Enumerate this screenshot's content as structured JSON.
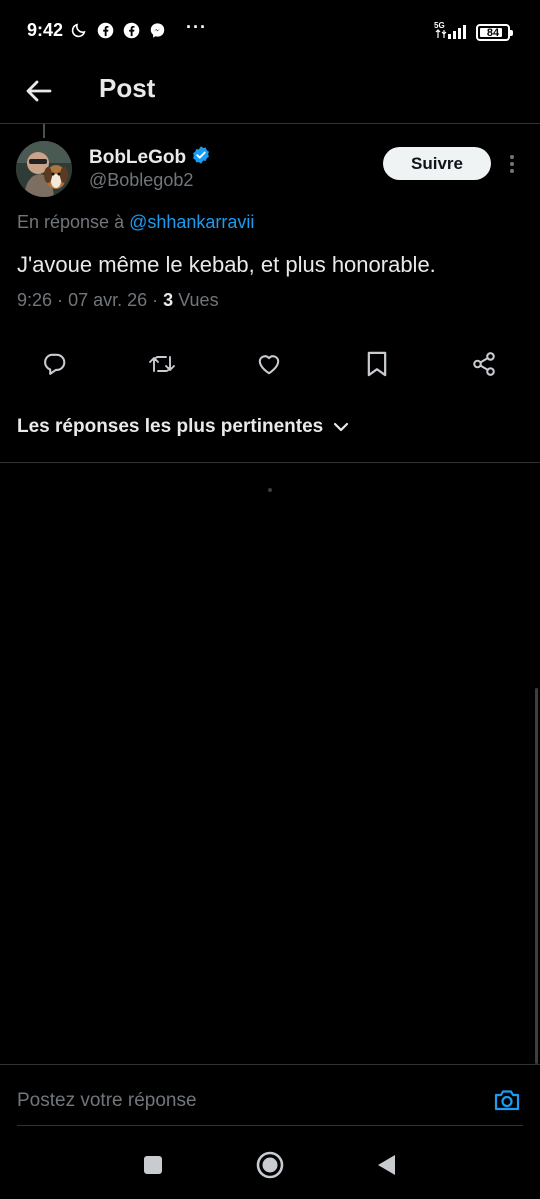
{
  "status_bar": {
    "time": "9:42",
    "network": "5G",
    "battery": "84",
    "battery_level": 0.84
  },
  "header": {
    "title": "Post"
  },
  "tweet": {
    "author_name": "BobLeGob",
    "author_handle": "@Boblegob2",
    "verified": true,
    "follow_label": "Suivre",
    "reply_prefix": "En réponse à",
    "reply_mention": "@shhankarravii",
    "text": "J'avoue même le kebab, et plus honorable.",
    "time": "9:26",
    "date": "07 avr. 26",
    "separator": "·",
    "views_count": "3",
    "views_label": "Vues"
  },
  "actions": [
    "reply-icon",
    "retweet-icon",
    "like-icon",
    "bookmark-icon",
    "share-icon"
  ],
  "sort": {
    "label": "Les réponses les plus pertinentes"
  },
  "composer": {
    "placeholder": "Postez votre réponse"
  },
  "colors": {
    "accent": "#1d9bf0",
    "background": "#000000",
    "text": "#e7e9ea",
    "muted": "#71767b"
  }
}
